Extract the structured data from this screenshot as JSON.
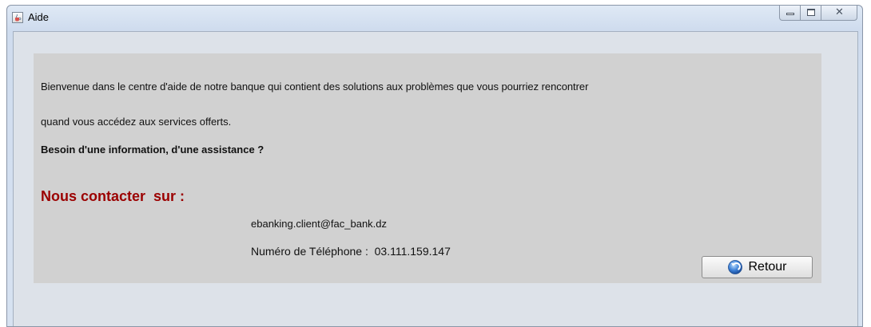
{
  "window": {
    "title": "Aide",
    "icon": "java-cup-icon",
    "controls": {
      "minimize": "minimize-icon",
      "maximize": "maximize-icon",
      "close": "close-icon",
      "close_glyph": "✕"
    }
  },
  "content": {
    "intro_line1": "Bienvenue dans le centre d'aide de notre banque qui contient des solutions aux problèmes que vous pourriez rencontrer",
    "intro_line2": "quand vous accédez aux services offerts.",
    "question": "Besoin d'une information, d'une assistance ?",
    "contact_heading": "Nous contacter  sur :",
    "email": "ebanking.client@fac_bank.dz",
    "phone": "Numéro de Téléphone :  03.111.159.147"
  },
  "buttons": {
    "retour_label": "Retour",
    "retour_icon": "back-arrow-icon"
  },
  "colors": {
    "heading": "#9b0000",
    "panel": "#d1d1d1",
    "client_bg": "#dde2e9"
  }
}
